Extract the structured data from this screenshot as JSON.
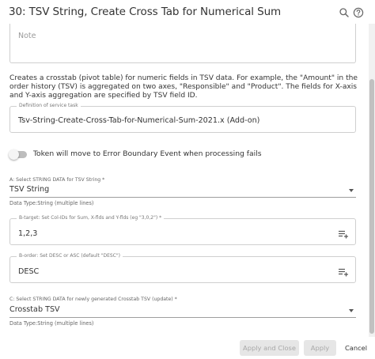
{
  "header": {
    "title": "30: TSV String, Create Cross Tab for Numerical Sum",
    "search_icon": "search-icon",
    "help_icon": "help-icon"
  },
  "note": {
    "placeholder": "Note"
  },
  "description": "Creates a crosstab (pivot table) for numeric fields in TSV data. For example, the \"Amount\" in the order history (TSV) is aggregated on two axes, \"Responsible\" and \"Product\". The fields for X-axis and Y-axis aggregation are specified by TSV field ID.",
  "service_task": {
    "legend": "Definition of service task",
    "value": "Tsv-String-Create-Cross-Tab-for-Numerical-Sum-2021.x (Add-on)"
  },
  "toggle": {
    "label": "Token will move to Error Boundary Event when processing fails",
    "on": false
  },
  "field_a": {
    "label": "A: Select STRING DATA for TSV String *",
    "value": "TSV String",
    "helper": "Data Type:String (multiple lines)"
  },
  "field_b_target": {
    "legend": "B-target: Set Col-IDs for Sum, X-flds and Y-flds (eg \"3,0,2\") *",
    "value": "1,2,3",
    "button_icon": "insert-variable-icon"
  },
  "field_b_order": {
    "legend": "B-order: Set DESC or ASC (default \"DESC\")",
    "value": "DESC",
    "button_icon": "insert-variable-icon"
  },
  "field_c": {
    "label": "C: Select STRING DATA for newly generated Crosstab TSV (update) *",
    "value": "Crosstab TSV",
    "helper": "Data Type:String (multiple lines)"
  },
  "footer": {
    "apply_close_label": "Apply and Close",
    "apply_label": "Apply",
    "cancel_label": "Cancel"
  },
  "colors": {
    "disabled_button_bg": "#e6e6e6",
    "disabled_button_text": "#a8a8a8",
    "border": "#cfcfcf"
  }
}
